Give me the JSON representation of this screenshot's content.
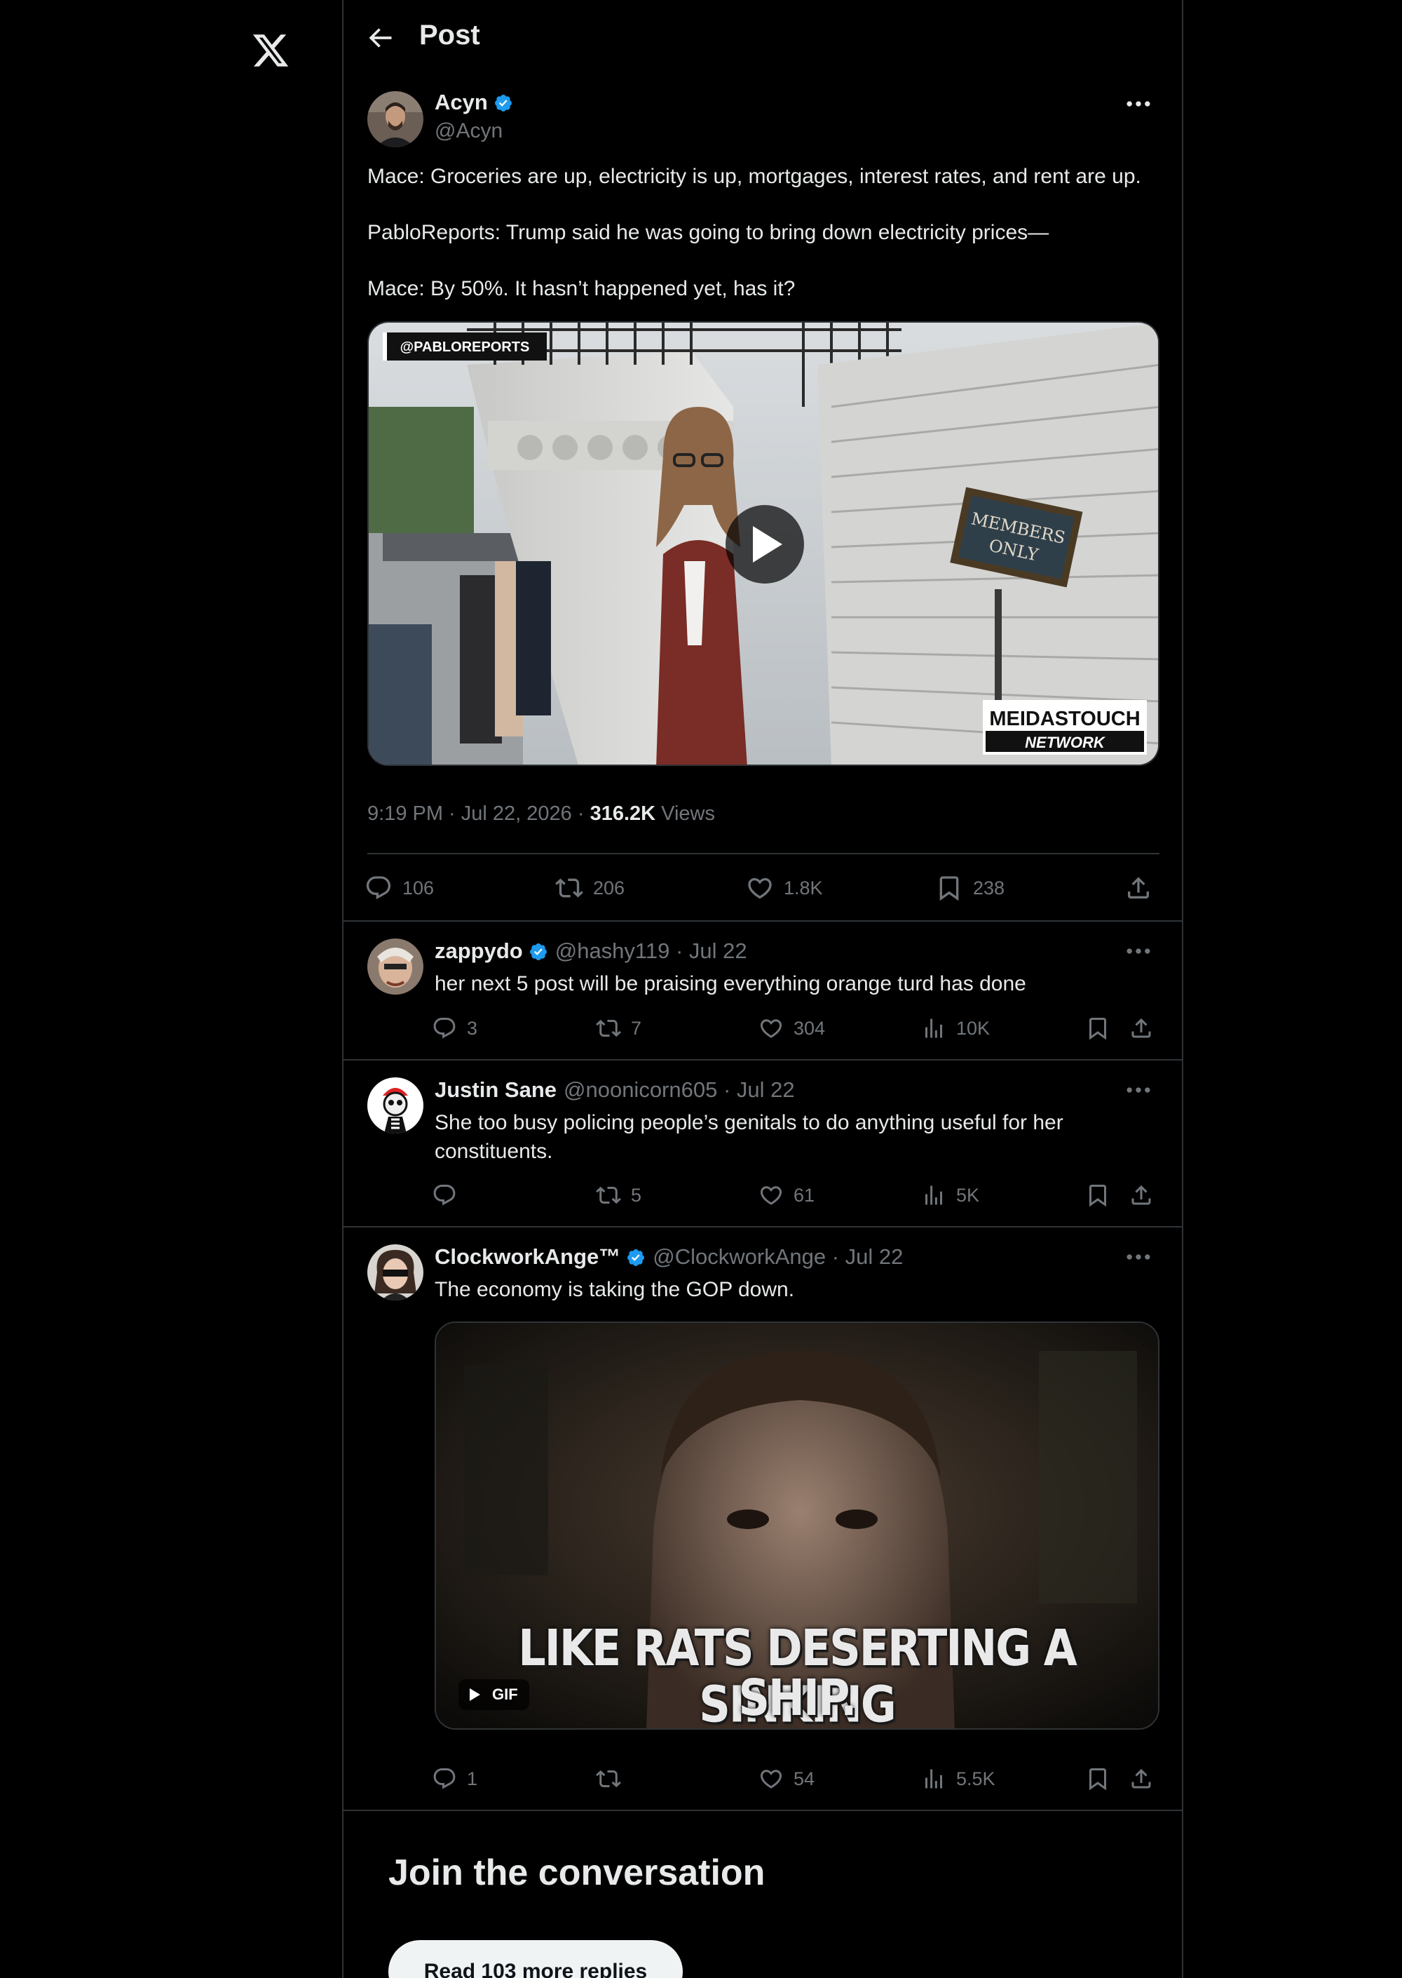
{
  "nav": {
    "logo_icon": "x-logo-icon"
  },
  "header": {
    "title": "Post",
    "back_icon": "arrow-left-icon"
  },
  "main_post": {
    "author": {
      "name": "Acyn",
      "handle": "@Acyn",
      "verified": true
    },
    "text_lines": [
      "Mace: Groceries are up, electricity is up, mortgages, interest rates, and rent are up.",
      "PabloReports: Trump said he was going to bring down electricity prices—",
      "Mace: By 50%. It hasn’t happened yet, has it?"
    ],
    "video": {
      "watermark": "@PABLOREPORTS",
      "sign": "MEMBERS ONLY",
      "brand_top": "MEIDASTOUCH",
      "brand_bottom": "NETWORK"
    },
    "timestamp": "9:19 PM · Jul 22, 2026 · ",
    "views_count": "316.2K",
    "views_label": " Views",
    "stats": {
      "replies": "106",
      "reposts": "206",
      "likes": "1.8K",
      "bookmarks": "238"
    }
  },
  "replies": [
    {
      "name": "zappydo",
      "verified": true,
      "handle": "@hashy119",
      "date": " · Jul 22",
      "text": "her next 5 post will be praising everything orange turd has done",
      "stats": {
        "replies": "3",
        "reposts": "7",
        "likes": "304",
        "views": "10K"
      }
    },
    {
      "name": "Justin Sane",
      "verified": false,
      "handle": "@noonicorn605",
      "date": " · Jul 22",
      "text": "She too busy policing people’s genitals to do anything useful for her constituents.",
      "stats": {
        "replies": "",
        "reposts": "5",
        "likes": "61",
        "views": "5K"
      }
    },
    {
      "name": "ClockworkAnge™",
      "verified": true,
      "handle": "@ClockworkAnge",
      "date": " · Jul 22",
      "text": "The economy is taking the GOP down.",
      "gif": {
        "caption_line1": "LIKE RATS DESERTING A SINKING",
        "caption_line2": "SHIP.",
        "badge": "GIF"
      },
      "stats": {
        "replies": "1",
        "reposts": "",
        "likes": "54",
        "views": "5.5K"
      }
    }
  ],
  "footer": {
    "join_title": "Join the conversation",
    "read_more": "Read 103 more replies"
  },
  "colors": {
    "background": "#000000",
    "text": "#e7e9ea",
    "muted": "#71767b",
    "border": "#2f3336",
    "verified": "#1d9bf0"
  }
}
